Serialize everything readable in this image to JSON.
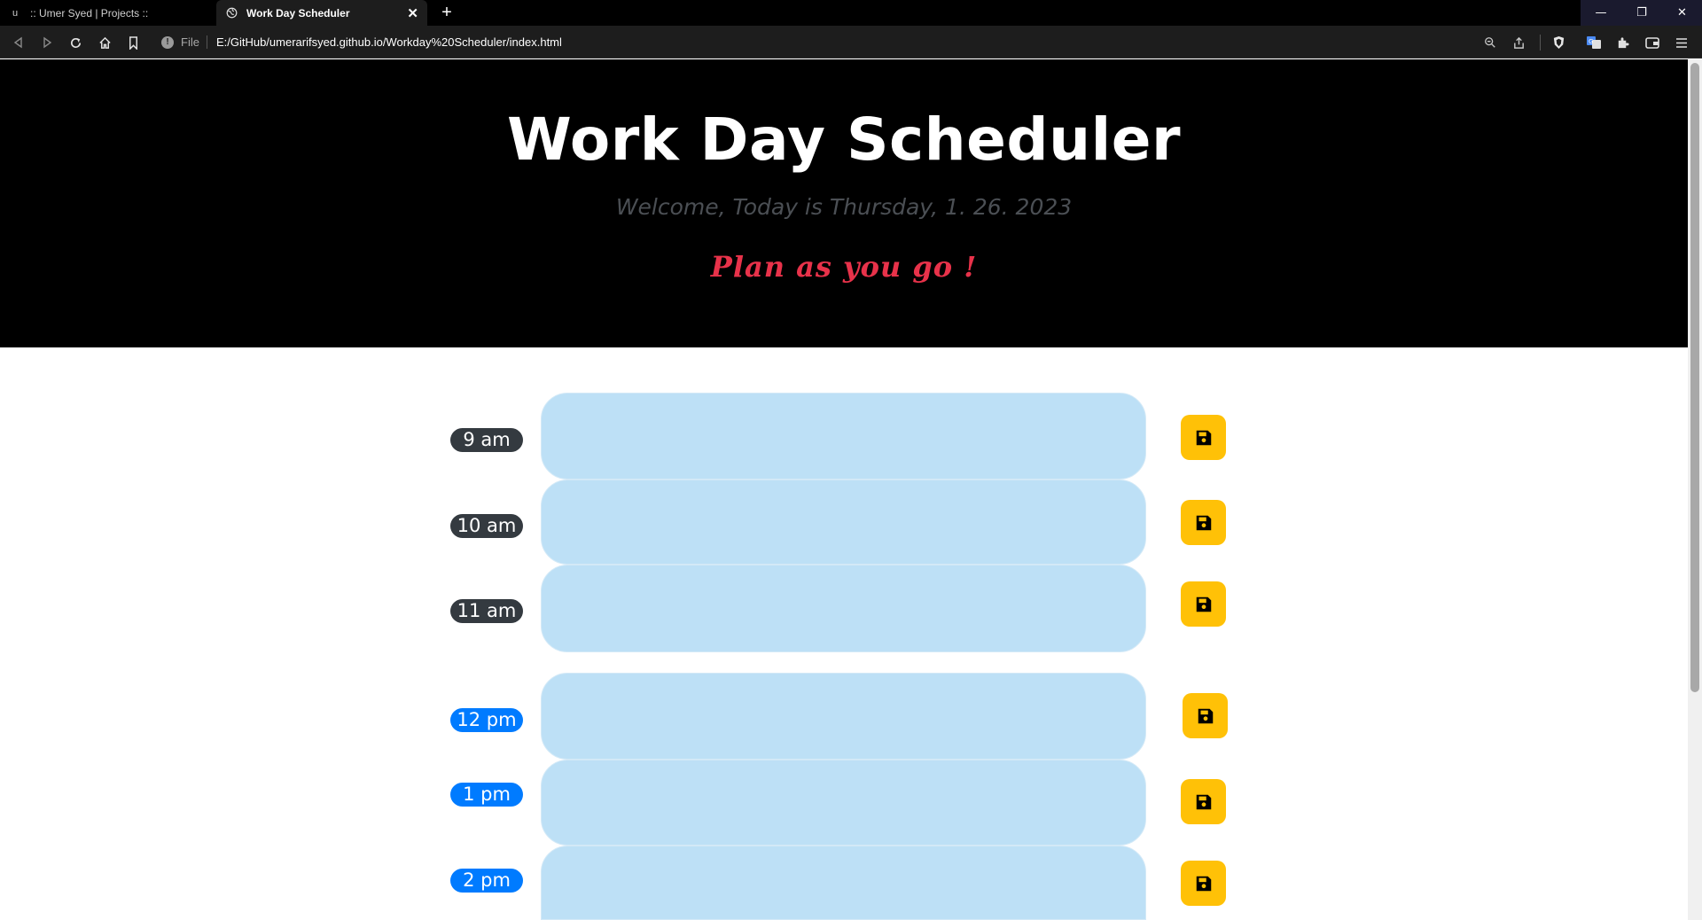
{
  "browser": {
    "tabs": [
      {
        "title": ":: Umer Syed | Projects ::",
        "favicon": "u"
      },
      {
        "title": "Work Day Scheduler",
        "close": "✕"
      }
    ],
    "new_tab_label": "+",
    "window_controls": {
      "minimize": "—",
      "maximize": "❐",
      "close": "✕"
    },
    "address": {
      "scheme_label": "File",
      "info_label": "!",
      "url": "E:/GitHub/umerarifsyed.github.io/Workday%20Scheduler/index.html"
    }
  },
  "page": {
    "title": "Work Day Scheduler",
    "welcome": "Welcome, Today is Thursday, 1. 26. 2023",
    "slogan": "Plan as you go !"
  },
  "hours": [
    {
      "label": "9 am",
      "state": "past",
      "value": ""
    },
    {
      "label": "10 am",
      "state": "past",
      "value": ""
    },
    {
      "label": "11 am",
      "state": "past",
      "value": ""
    },
    {
      "label": "12 pm",
      "state": "future",
      "value": ""
    },
    {
      "label": "1 pm",
      "state": "future",
      "value": ""
    },
    {
      "label": "2 pm",
      "state": "future",
      "value": ""
    }
  ],
  "colors": {
    "header_bg": "#000000",
    "slogan": "#e8324a",
    "past_badge": "#343a40",
    "future_badge": "#007bff",
    "input_bg": "#bde0f6",
    "save_bg": "#ffc107"
  },
  "icons": {
    "save": "floppy-disk-icon"
  }
}
